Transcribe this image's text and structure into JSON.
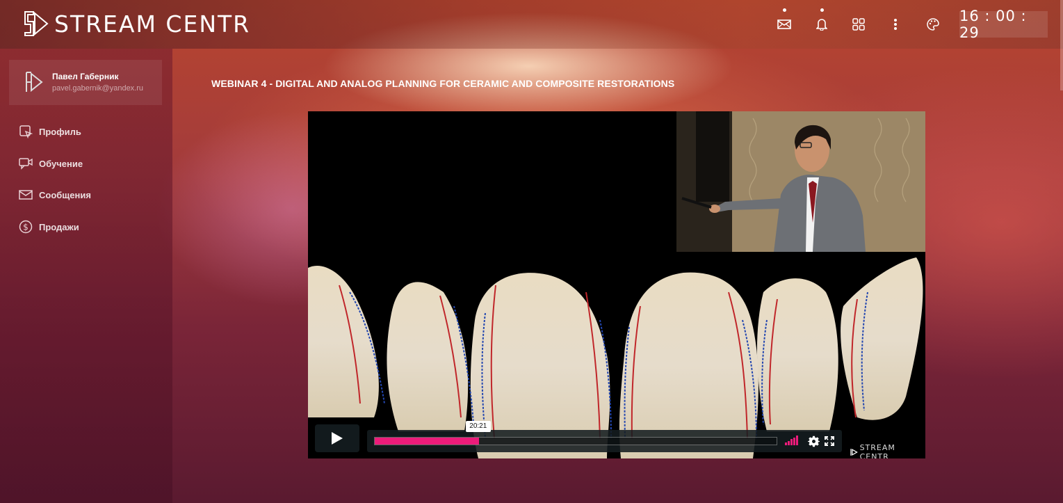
{
  "header": {
    "logo_text": "STREAM CENTR",
    "icons": [
      "mail-icon",
      "bell-icon",
      "apps-grid-icon",
      "more-vertical-icon",
      "palette-icon"
    ],
    "clock": "16 : 00 : 29"
  },
  "sidebar": {
    "user": {
      "name": "Павел Габерник",
      "email": "pavel.gabernik@yandex.ru"
    },
    "items": [
      {
        "label": "Профиль",
        "icon": "profile-icon"
      },
      {
        "label": "Обучение",
        "icon": "video-chat-icon"
      },
      {
        "label": "Сообщения",
        "icon": "envelope-icon"
      },
      {
        "label": "Продажи",
        "icon": "dollar-circle-icon"
      }
    ]
  },
  "main": {
    "title": "WEBINAR 4 - DIGITAL AND ANALOG PLANNING FOR CERAMIC AND COMPOSITE RESTORATIONS"
  },
  "player": {
    "hover_time": "20:21",
    "progress": 0.26,
    "volume_bars": 5,
    "watermark": "STREAM CENTR",
    "colors": {
      "accent": "#ec1c7a",
      "controls_bg": "#141c20"
    }
  }
}
